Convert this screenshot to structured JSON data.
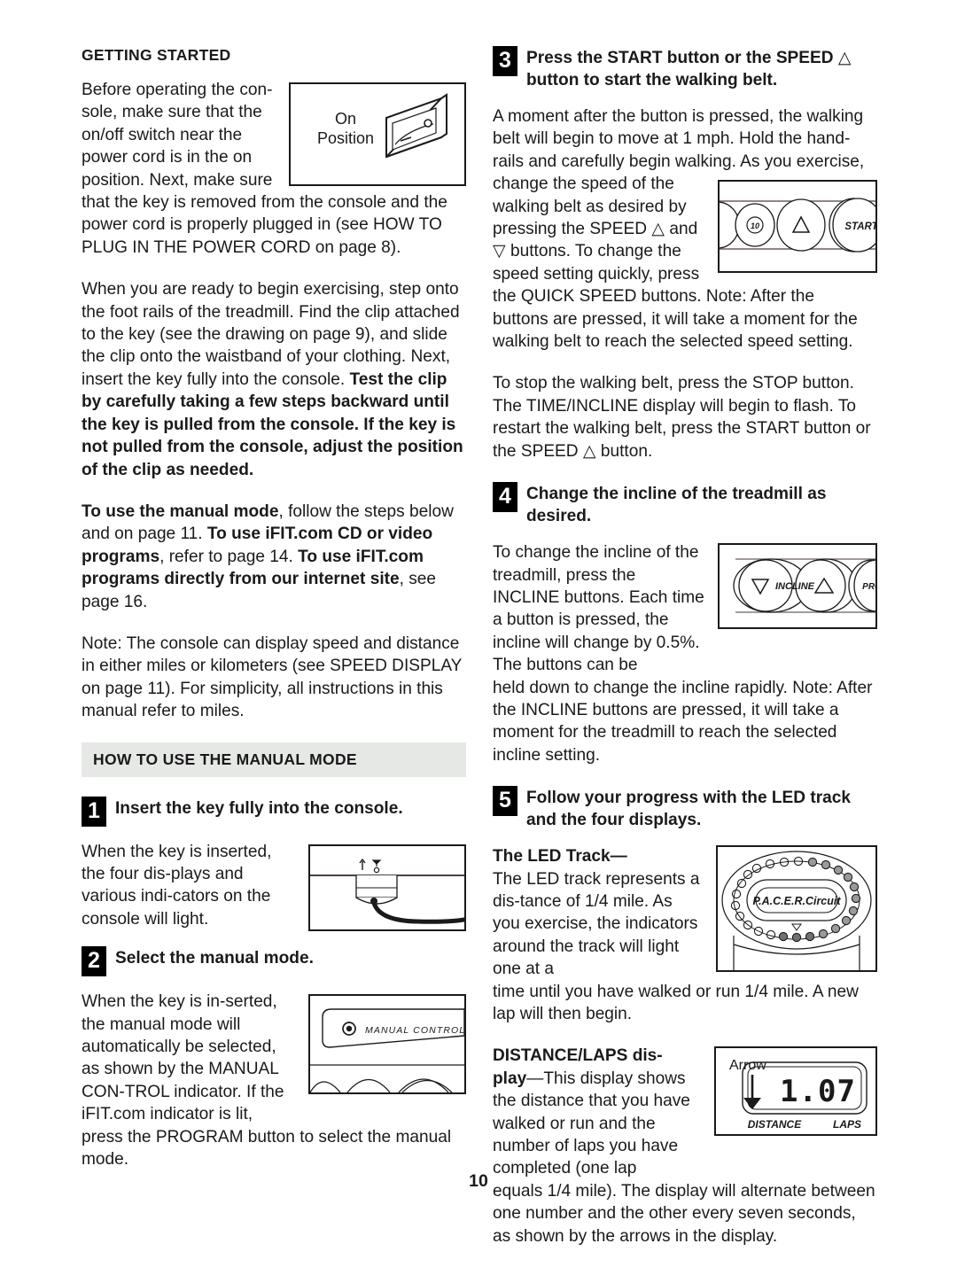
{
  "document": {
    "page_number": "10",
    "left_column": {
      "section_heading": "GETTING STARTED",
      "para1_a": "Before operating the con-sole, make sure that the on/off switch near the power cord is in the on position. Next, make sure that the key is removed",
      "para1_b": "from the console and the power cord is properly plugged in (see HOW TO PLUG IN THE POWER CORD on page 8).",
      "para2_plain1": "When you are ready to begin exercising, step onto the foot rails of the treadmill. Find the clip attached to the key (see the drawing on page 9), and slide the clip onto the waistband of your clothing. Next, insert the key fully into the console. ",
      "para2_bold1": "Test the clip by carefully taking a few steps backward until the key is pulled from the console. If the key is not pulled from the console, adjust the position of the clip as needed.",
      "para3_bold1": "To use the manual mode",
      "para3_plain1": ", follow the steps below and on page 11. ",
      "para3_bold2": "To use iFIT.com CD or video programs",
      "para3_plain2": ", refer to page 14. ",
      "para3_bold3": "To use iFIT.com programs directly from our internet site",
      "para3_plain3": ", see page 16.",
      "para4": "Note: The console can display speed and distance in either miles or kilometers (see SPEED DISPLAY on page 11). For simplicity, all instructions in this manual refer to miles.",
      "band_heading": "HOW TO USE THE MANUAL MODE",
      "step1": {
        "number": "1",
        "title": "Insert the key fully into the console.",
        "body": "When the key is inserted, the four dis-plays and various indi-cators on the console will light."
      },
      "step2": {
        "number": "2",
        "title": "Select the manual mode.",
        "body_a": "When the key is in-serted, the manual mode will automatically be selected, as shown by the MANUAL CON-TROL indicator. If the iFIT.com indicator is lit,",
        "body_b": "press the PROGRAM button to select the manual mode."
      },
      "fig_switch": {
        "label_line1": "On",
        "label_line2": "Position"
      },
      "fig_console_indicator": {
        "label": "MANUAL CONTROL"
      }
    },
    "right_column": {
      "step3": {
        "number": "3",
        "title_a": "Press the START button or the SPEED ",
        "title_triangle": "△",
        "title_b": " button to start the walking belt.",
        "body_a": "A moment after the button is pressed, the walking belt will begin to move at 1 mph. Hold the hand-rails and carefully begin walking. As you exercise,",
        "body_b_1": "change the speed of the walking belt as desired by pressing the SPEED ",
        "body_b_up": "△",
        "body_b_2": " and ",
        "body_b_dn": "▽",
        "body_b_3": " buttons. To change the speed setting quickly, press the QUICK SPEED buttons. Note: After the",
        "body_c": "buttons are pressed, it will take a moment for the walking belt to reach the selected speed setting.",
        "body_d_1": "To stop the walking belt, press the STOP button. The TIME/INCLINE display will begin to flash. To restart the walking belt, press the START button or the SPEED ",
        "body_d_tri": "△",
        "body_d_2": " button."
      },
      "fig_speed_buttons": {
        "quick_speed_label": "10",
        "up_arrow": "△",
        "start_label": "START"
      },
      "step4": {
        "number": "4",
        "title": "Change the incline of the treadmill as desired.",
        "body_a": "To change the incline of the treadmill, press the INCLINE buttons. Each time a button is pressed, the incline will change by 0.5%. The buttons can be",
        "body_b": "held down to change the incline rapidly. Note: After the INCLINE buttons are pressed, it will take a moment for the treadmill to reach the selected incline setting."
      },
      "fig_incline_buttons": {
        "down_arrow": "▽",
        "incline_label": "INCLINE",
        "up_arrow": "△",
        "program_label": "PRO"
      },
      "step5": {
        "number": "5",
        "title": "Follow your progress with the LED track and the four displays.",
        "led_bold": "The LED Track—",
        "led_body_a": "The LED track represents a dis-tance of 1/4 mile. As you exercise, the indicators around the track will light one at a",
        "led_body_b": "time until you have walked or run 1/4 mile. A new lap will then begin.",
        "dist_bold_a": "DISTANCE/LAPS dis-",
        "dist_bold_b": "play",
        "dist_plain_a": "—This display shows the distance that you have walked or run and the number of laps you have completed (one lap",
        "dist_plain_b": "equals 1/4 mile). The display will alternate between one number and the other every seven seconds, as shown by the arrows in the display."
      },
      "fig_led_track": {
        "logo": "P.A.C.E.R. Circuit"
      },
      "fig_distance_display": {
        "arrow_label": "Arrow",
        "value": "1.07",
        "left_label": "DISTANCE",
        "right_label": "LAPS"
      }
    }
  },
  "colors": {
    "ink": "#1a1a1a",
    "band_bg": "#e6e8e6",
    "paper": "#ffffff"
  }
}
